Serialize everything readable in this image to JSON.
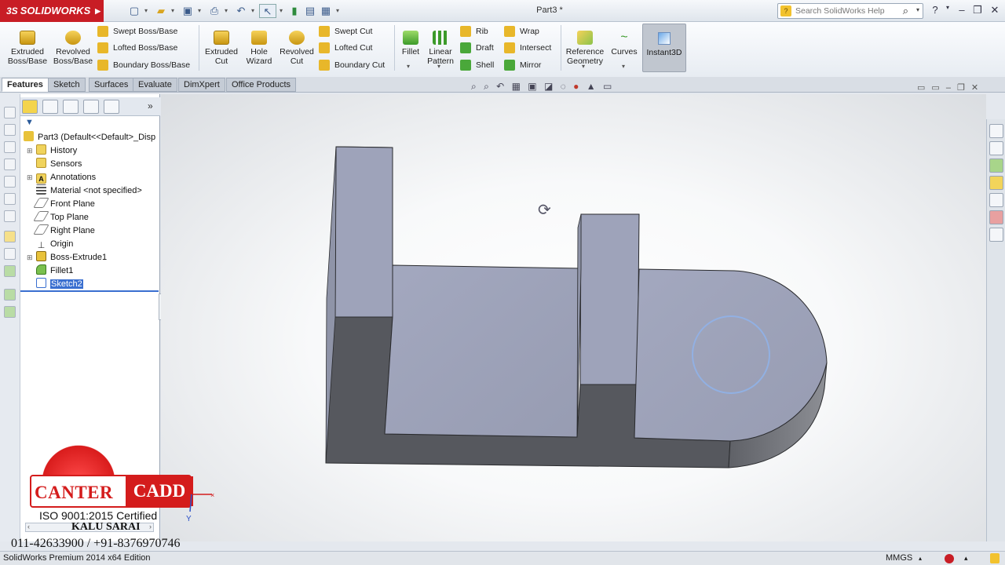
{
  "app": {
    "logo_text": "SOLIDWORKS",
    "logo_prefix": "3S",
    "doc_title": "Part3 *"
  },
  "search": {
    "placeholder": "Search SolidWorks Help"
  },
  "ribbon": {
    "large_buttons": [
      {
        "label": "Extruded\nBoss/Base",
        "icon": "extruded-boss-icon"
      },
      {
        "label": "Revolved\nBoss/Base",
        "icon": "revolved-boss-icon"
      },
      {
        "label": "Extruded\nCut",
        "icon": "extruded-cut-icon"
      },
      {
        "label": "Hole\nWizard",
        "icon": "hole-wizard-icon"
      },
      {
        "label": "Revolved\nCut",
        "icon": "revolved-cut-icon"
      },
      {
        "label": "Fillet",
        "icon": "fillet-icon"
      },
      {
        "label": "Linear\nPattern",
        "icon": "linear-pattern-icon"
      },
      {
        "label": "Reference\nGeometry",
        "icon": "reference-geometry-icon"
      },
      {
        "label": "Curves",
        "icon": "curves-icon"
      },
      {
        "label": "Instant3D",
        "icon": "instant3d-icon"
      }
    ],
    "small_buttons": {
      "swept_boss": "Swept Boss/Base",
      "lofted_boss": "Lofted Boss/Base",
      "boundary_boss": "Boundary Boss/Base",
      "swept_cut": "Swept Cut",
      "lofted_cut": "Lofted Cut",
      "boundary_cut": "Boundary Cut",
      "rib": "Rib",
      "draft": "Draft",
      "shell": "Shell",
      "wrap": "Wrap",
      "intersect": "Intersect",
      "mirror": "Mirror"
    }
  },
  "tabs": [
    "Features",
    "Sketch",
    "Surfaces",
    "Evaluate",
    "DimXpert",
    "Office Products"
  ],
  "tree": {
    "root": "Part3  (Default<<Default>_Disp",
    "items": [
      "History",
      "Sensors",
      "Annotations",
      "Material <not specified>",
      "Front Plane",
      "Top Plane",
      "Right Plane",
      "Origin",
      "Boss-Extrude1",
      "Fillet1",
      "Sketch2"
    ],
    "selected": "Sketch2"
  },
  "status": {
    "left": "SolidWorks Premium 2014 x64 Edition",
    "units": "MMGS"
  },
  "watermark": {
    "brand_left": "CANTER",
    "brand_right": "CADD",
    "cert": "ISO 9001:2015 Certified",
    "location": "KALU SARAI",
    "phone": "011-42633900 / +91-8376970746"
  },
  "colors": {
    "accent": "#c81d25",
    "model_light": "#9ea3ba",
    "model_dark": "#56585e",
    "selection": "#3a6fd0"
  }
}
